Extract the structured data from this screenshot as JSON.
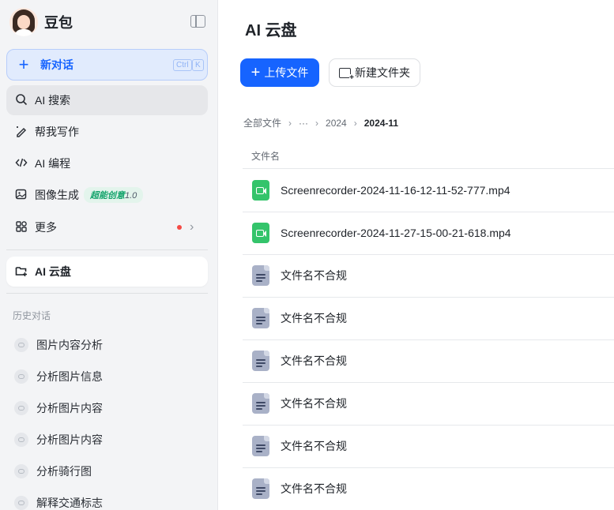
{
  "sidebar": {
    "brand": "豆包",
    "new_chat": {
      "label": "新对话",
      "shortcut_ctrl": "Ctrl",
      "shortcut_key": "K"
    },
    "nav": [
      {
        "label": "AI 搜索",
        "icon": "search-icon"
      },
      {
        "label": "帮我写作",
        "icon": "pen-icon"
      },
      {
        "label": "AI 编程",
        "icon": "code-icon"
      },
      {
        "label": "图像生成",
        "icon": "image-icon",
        "badge": "超能创意",
        "badge_version": "1.0"
      },
      {
        "label": "更多",
        "icon": "grid-icon"
      }
    ],
    "drive": {
      "label": "AI 云盘",
      "icon": "drive-icon"
    },
    "history_title": "历史对话",
    "history": [
      "图片内容分析",
      "分析图片信息",
      "分析图片内容",
      "分析图片内容",
      "分析骑行图",
      "解释交通标志"
    ]
  },
  "main": {
    "title": "AI 云盘",
    "upload_label": "上传文件",
    "new_folder_label": "新建文件夹",
    "breadcrumb": [
      "全部文件",
      "···",
      "2024",
      "2024-11"
    ],
    "column_name": "文件名",
    "files": [
      {
        "name": "Screenrecorder-2024-11-16-12-11-52-777.mp4",
        "type": "video"
      },
      {
        "name": "Screenrecorder-2024-11-27-15-00-21-618.mp4",
        "type": "video"
      },
      {
        "name": "文件名不合规",
        "type": "doc"
      },
      {
        "name": "文件名不合规",
        "type": "doc"
      },
      {
        "name": "文件名不合规",
        "type": "doc"
      },
      {
        "name": "文件名不合规",
        "type": "doc"
      },
      {
        "name": "文件名不合规",
        "type": "doc"
      },
      {
        "name": "文件名不合规",
        "type": "doc"
      }
    ]
  },
  "colors": {
    "accent": "#1664ff",
    "sidebar_bg": "#f3f4f6",
    "video_icon": "#34c46b",
    "doc_icon": "#a9b1c7"
  }
}
